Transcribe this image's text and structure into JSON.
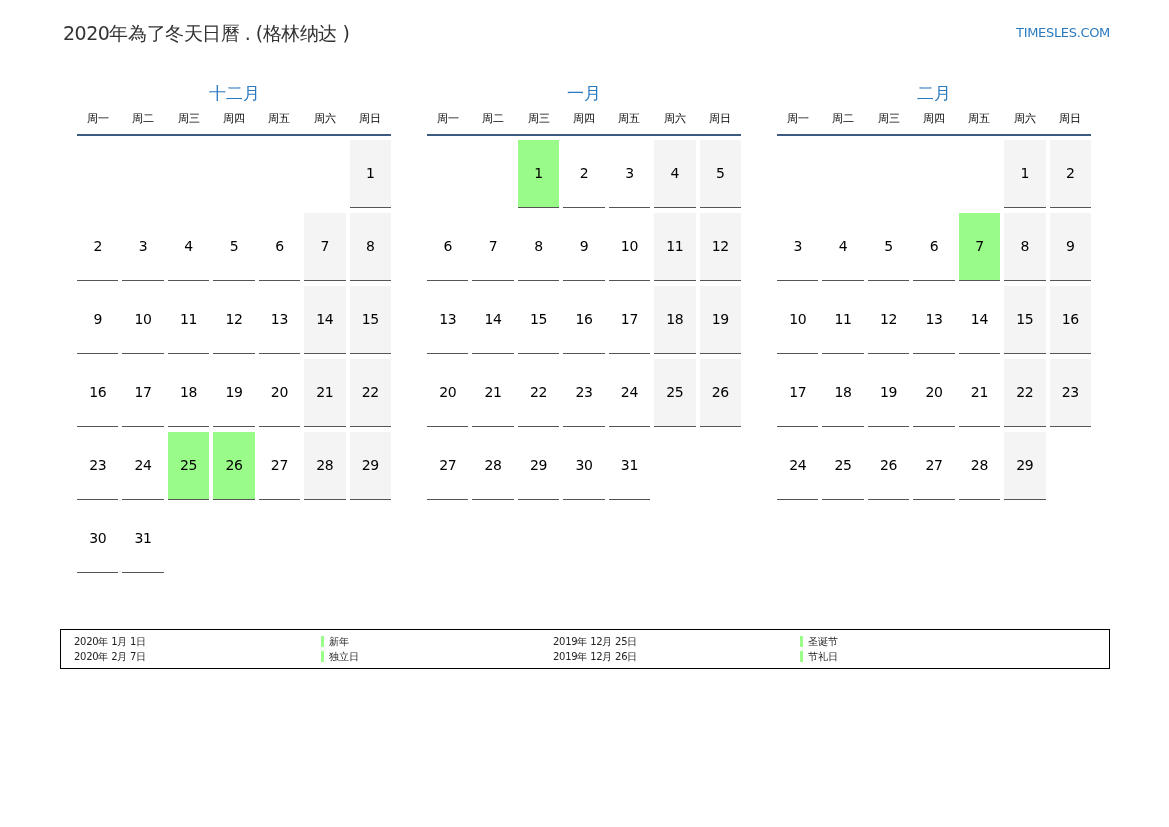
{
  "title": "2020年為了冬天日曆 . (格林纳达 )",
  "site": "TIMESLES.COM",
  "months": [
    {
      "name": "十二月",
      "weekdays": [
        "周一",
        "周二",
        "周三",
        "周四",
        "周五",
        "周六",
        "周日"
      ],
      "weeks": [
        [
          {
            "kind": "blank"
          },
          {
            "kind": "blank"
          },
          {
            "kind": "blank"
          },
          {
            "kind": "blank"
          },
          {
            "kind": "blank"
          },
          {
            "kind": "blank"
          },
          {
            "day": "1",
            "kind": "weekend"
          }
        ],
        [
          {
            "day": "2",
            "kind": "weekday"
          },
          {
            "day": "3",
            "kind": "weekday"
          },
          {
            "day": "4",
            "kind": "weekday"
          },
          {
            "day": "5",
            "kind": "weekday"
          },
          {
            "day": "6",
            "kind": "weekday"
          },
          {
            "day": "7",
            "kind": "weekend"
          },
          {
            "day": "8",
            "kind": "weekend"
          }
        ],
        [
          {
            "day": "9",
            "kind": "weekday"
          },
          {
            "day": "10",
            "kind": "weekday"
          },
          {
            "day": "11",
            "kind": "weekday"
          },
          {
            "day": "12",
            "kind": "weekday"
          },
          {
            "day": "13",
            "kind": "weekday"
          },
          {
            "day": "14",
            "kind": "weekend"
          },
          {
            "day": "15",
            "kind": "weekend"
          }
        ],
        [
          {
            "day": "16",
            "kind": "weekday"
          },
          {
            "day": "17",
            "kind": "weekday"
          },
          {
            "day": "18",
            "kind": "weekday"
          },
          {
            "day": "19",
            "kind": "weekday"
          },
          {
            "day": "20",
            "kind": "weekday"
          },
          {
            "day": "21",
            "kind": "weekend"
          },
          {
            "day": "22",
            "kind": "weekend"
          }
        ],
        [
          {
            "day": "23",
            "kind": "weekday"
          },
          {
            "day": "24",
            "kind": "weekday"
          },
          {
            "day": "25",
            "kind": "holiday"
          },
          {
            "day": "26",
            "kind": "holiday"
          },
          {
            "day": "27",
            "kind": "weekday"
          },
          {
            "day": "28",
            "kind": "weekend"
          },
          {
            "day": "29",
            "kind": "weekend"
          }
        ],
        [
          {
            "day": "30",
            "kind": "weekday"
          },
          {
            "day": "31",
            "kind": "weekday"
          }
        ]
      ]
    },
    {
      "name": "一月",
      "weekdays": [
        "周一",
        "周二",
        "周三",
        "周四",
        "周五",
        "周六",
        "周日"
      ],
      "weeks": [
        [
          {
            "kind": "blank"
          },
          {
            "kind": "blank"
          },
          {
            "day": "1",
            "kind": "holiday"
          },
          {
            "day": "2",
            "kind": "weekday"
          },
          {
            "day": "3",
            "kind": "weekday"
          },
          {
            "day": "4",
            "kind": "weekend"
          },
          {
            "day": "5",
            "kind": "weekend"
          }
        ],
        [
          {
            "day": "6",
            "kind": "weekday"
          },
          {
            "day": "7",
            "kind": "weekday"
          },
          {
            "day": "8",
            "kind": "weekday"
          },
          {
            "day": "9",
            "kind": "weekday"
          },
          {
            "day": "10",
            "kind": "weekday"
          },
          {
            "day": "11",
            "kind": "weekend"
          },
          {
            "day": "12",
            "kind": "weekend"
          }
        ],
        [
          {
            "day": "13",
            "kind": "weekday"
          },
          {
            "day": "14",
            "kind": "weekday"
          },
          {
            "day": "15",
            "kind": "weekday"
          },
          {
            "day": "16",
            "kind": "weekday"
          },
          {
            "day": "17",
            "kind": "weekday"
          },
          {
            "day": "18",
            "kind": "weekend"
          },
          {
            "day": "19",
            "kind": "weekend"
          }
        ],
        [
          {
            "day": "20",
            "kind": "weekday"
          },
          {
            "day": "21",
            "kind": "weekday"
          },
          {
            "day": "22",
            "kind": "weekday"
          },
          {
            "day": "23",
            "kind": "weekday"
          },
          {
            "day": "24",
            "kind": "weekday"
          },
          {
            "day": "25",
            "kind": "weekend"
          },
          {
            "day": "26",
            "kind": "weekend"
          }
        ],
        [
          {
            "day": "27",
            "kind": "weekday"
          },
          {
            "day": "28",
            "kind": "weekday"
          },
          {
            "day": "29",
            "kind": "weekday"
          },
          {
            "day": "30",
            "kind": "weekday"
          },
          {
            "day": "31",
            "kind": "weekday"
          }
        ]
      ]
    },
    {
      "name": "二月",
      "weekdays": [
        "周一",
        "周二",
        "周三",
        "周四",
        "周五",
        "周六",
        "周日"
      ],
      "weeks": [
        [
          {
            "kind": "blank"
          },
          {
            "kind": "blank"
          },
          {
            "kind": "blank"
          },
          {
            "kind": "blank"
          },
          {
            "kind": "blank"
          },
          {
            "day": "1",
            "kind": "weekend"
          },
          {
            "day": "2",
            "kind": "weekend"
          }
        ],
        [
          {
            "day": "3",
            "kind": "weekday"
          },
          {
            "day": "4",
            "kind": "weekday"
          },
          {
            "day": "5",
            "kind": "weekday"
          },
          {
            "day": "6",
            "kind": "weekday"
          },
          {
            "day": "7",
            "kind": "holiday"
          },
          {
            "day": "8",
            "kind": "weekend"
          },
          {
            "day": "9",
            "kind": "weekend"
          }
        ],
        [
          {
            "day": "10",
            "kind": "weekday"
          },
          {
            "day": "11",
            "kind": "weekday"
          },
          {
            "day": "12",
            "kind": "weekday"
          },
          {
            "day": "13",
            "kind": "weekday"
          },
          {
            "day": "14",
            "kind": "weekday"
          },
          {
            "day": "15",
            "kind": "weekend"
          },
          {
            "day": "16",
            "kind": "weekend"
          }
        ],
        [
          {
            "day": "17",
            "kind": "weekday"
          },
          {
            "day": "18",
            "kind": "weekday"
          },
          {
            "day": "19",
            "kind": "weekday"
          },
          {
            "day": "20",
            "kind": "weekday"
          },
          {
            "day": "21",
            "kind": "weekday"
          },
          {
            "day": "22",
            "kind": "weekend"
          },
          {
            "day": "23",
            "kind": "weekend"
          }
        ],
        [
          {
            "day": "24",
            "kind": "weekday"
          },
          {
            "day": "25",
            "kind": "weekday"
          },
          {
            "day": "26",
            "kind": "weekday"
          },
          {
            "day": "27",
            "kind": "weekday"
          },
          {
            "day": "28",
            "kind": "weekday"
          },
          {
            "day": "29",
            "kind": "weekend"
          }
        ]
      ]
    }
  ],
  "legend": [
    [
      {
        "date": "2020年 1月 1日",
        "color": "#99ff88",
        "name": "新年"
      },
      {
        "date": "2020年 2月 7日",
        "color": "#99ff88",
        "name": "独立日"
      }
    ],
    [
      {
        "date": "2019年 12月 25日",
        "color": "#99ff88",
        "name": "圣诞节"
      },
      {
        "date": "2019年 12月 26日",
        "color": "#99ff88",
        "name": "节礼日"
      }
    ]
  ]
}
